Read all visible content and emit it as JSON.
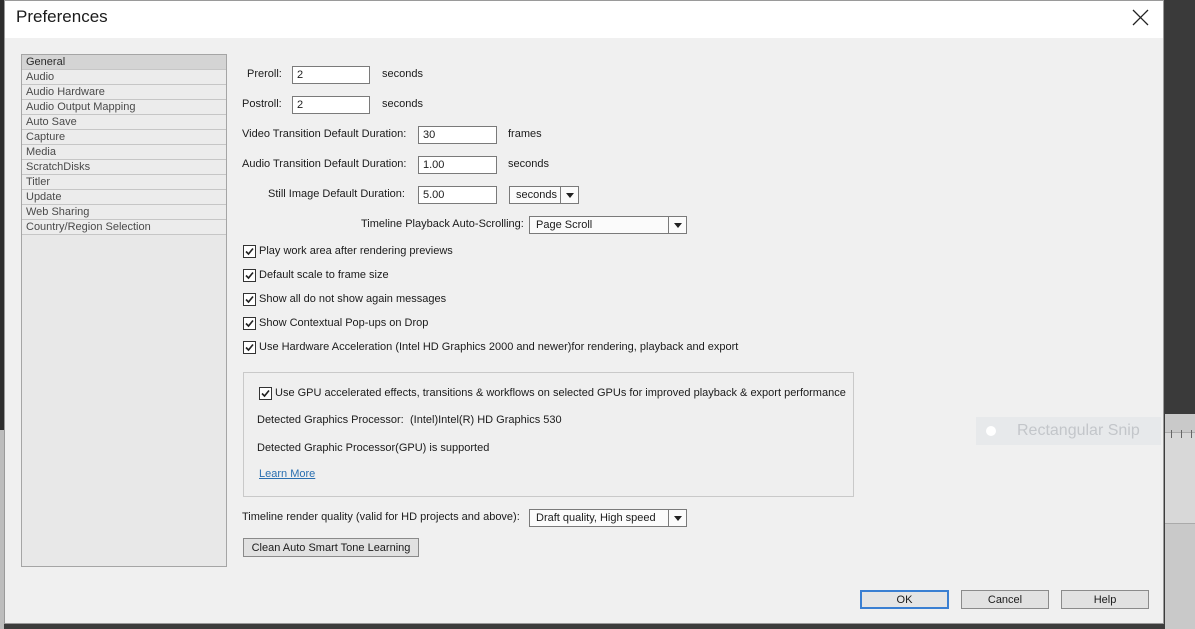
{
  "window": {
    "title": "Preferences",
    "close_icon": "close-icon"
  },
  "categories": [
    "General",
    "Audio",
    "Audio Hardware",
    "Audio Output Mapping",
    "Auto Save",
    "Capture",
    "Media",
    "ScratchDisks",
    "Titler",
    "Update",
    "Web Sharing",
    "Country/Region Selection"
  ],
  "selected_category": "General",
  "general": {
    "preroll": {
      "label": "Preroll:",
      "value": "2",
      "unit": "seconds"
    },
    "postroll": {
      "label": "Postroll:",
      "value": "2",
      "unit": "seconds"
    },
    "video_transition": {
      "label": "Video Transition Default Duration:",
      "value": "30",
      "unit": "frames"
    },
    "audio_transition": {
      "label": "Audio Transition Default Duration:",
      "value": "1.00",
      "unit": "seconds"
    },
    "still_image": {
      "label": "Still Image Default Duration:",
      "value": "5.00",
      "unit_selected": "seconds"
    },
    "auto_scrolling": {
      "label": "Timeline Playback Auto-Scrolling:",
      "selected": "Page Scroll"
    },
    "checkboxes": [
      {
        "label": "Play work area after rendering previews",
        "checked": true
      },
      {
        "label": "Default scale to frame size",
        "checked": true
      },
      {
        "label": "Show all do not show again messages",
        "checked": true
      },
      {
        "label": "Show Contextual Pop-ups on Drop",
        "checked": true
      },
      {
        "label": "Use Hardware Acceleration (Intel HD Graphics 2000 and newer)for rendering, playback and export",
        "checked": true
      }
    ],
    "gpu": {
      "checkbox_label": "Use GPU accelerated effects, transitions & workflows on selected GPUs for improved playback & export performance",
      "checked": true,
      "detected_label": "Detected Graphics Processor:",
      "detected_value": "(Intel)Intel(R) HD Graphics 530",
      "supported_text": "Detected Graphic Processor(GPU) is supported",
      "learn_more": "Learn More"
    },
    "render_quality": {
      "label": "Timeline render quality (valid for HD projects and above):",
      "selected": "Draft quality, High speed"
    },
    "clean_button": "Clean Auto Smart Tone Learning"
  },
  "buttons": {
    "ok": "OK",
    "cancel": "Cancel",
    "help": "Help"
  },
  "overlay": {
    "snip_text": "Rectangular Snip"
  },
  "colors": {
    "link": "#2a6fb0",
    "default_button_border": "#3a7fd2"
  }
}
